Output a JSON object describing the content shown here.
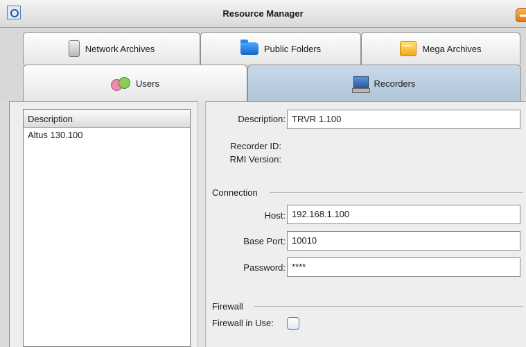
{
  "window": {
    "title": "Resource Manager"
  },
  "tabs": [
    {
      "label": "Network Archives",
      "icon": "network-archive-icon",
      "active": false
    },
    {
      "label": "Public Folders",
      "icon": "folder-icon",
      "active": false
    },
    {
      "label": "Mega Archives",
      "icon": "mega-archive-icon",
      "active": false
    },
    {
      "label": "Users",
      "icon": "users-icon",
      "active": false
    },
    {
      "label": "Recorders",
      "icon": "recorder-icon",
      "active": true
    }
  ],
  "list": {
    "header": "Description",
    "items": [
      "Altus 130.100"
    ]
  },
  "form": {
    "description": {
      "label": "Description:",
      "value": "TRVR 1.100"
    },
    "recorder_id": {
      "label": "Recorder ID:"
    },
    "rmi_version": {
      "label": "RMI Version:"
    },
    "connection": {
      "title": "Connection",
      "host": {
        "label": "Host:",
        "value": "192.168.1.100"
      },
      "base_port": {
        "label": "Base Port:",
        "value": "10010"
      },
      "password": {
        "label": "Password:",
        "value": "****"
      }
    },
    "firewall": {
      "title": "Firewall",
      "in_use": {
        "label": "Firewall in Use:",
        "checked": false
      }
    }
  },
  "colors": {
    "active_tab": "#aec5d8",
    "panel_bg": "#eeeeee",
    "title_button": "#e07a10"
  }
}
